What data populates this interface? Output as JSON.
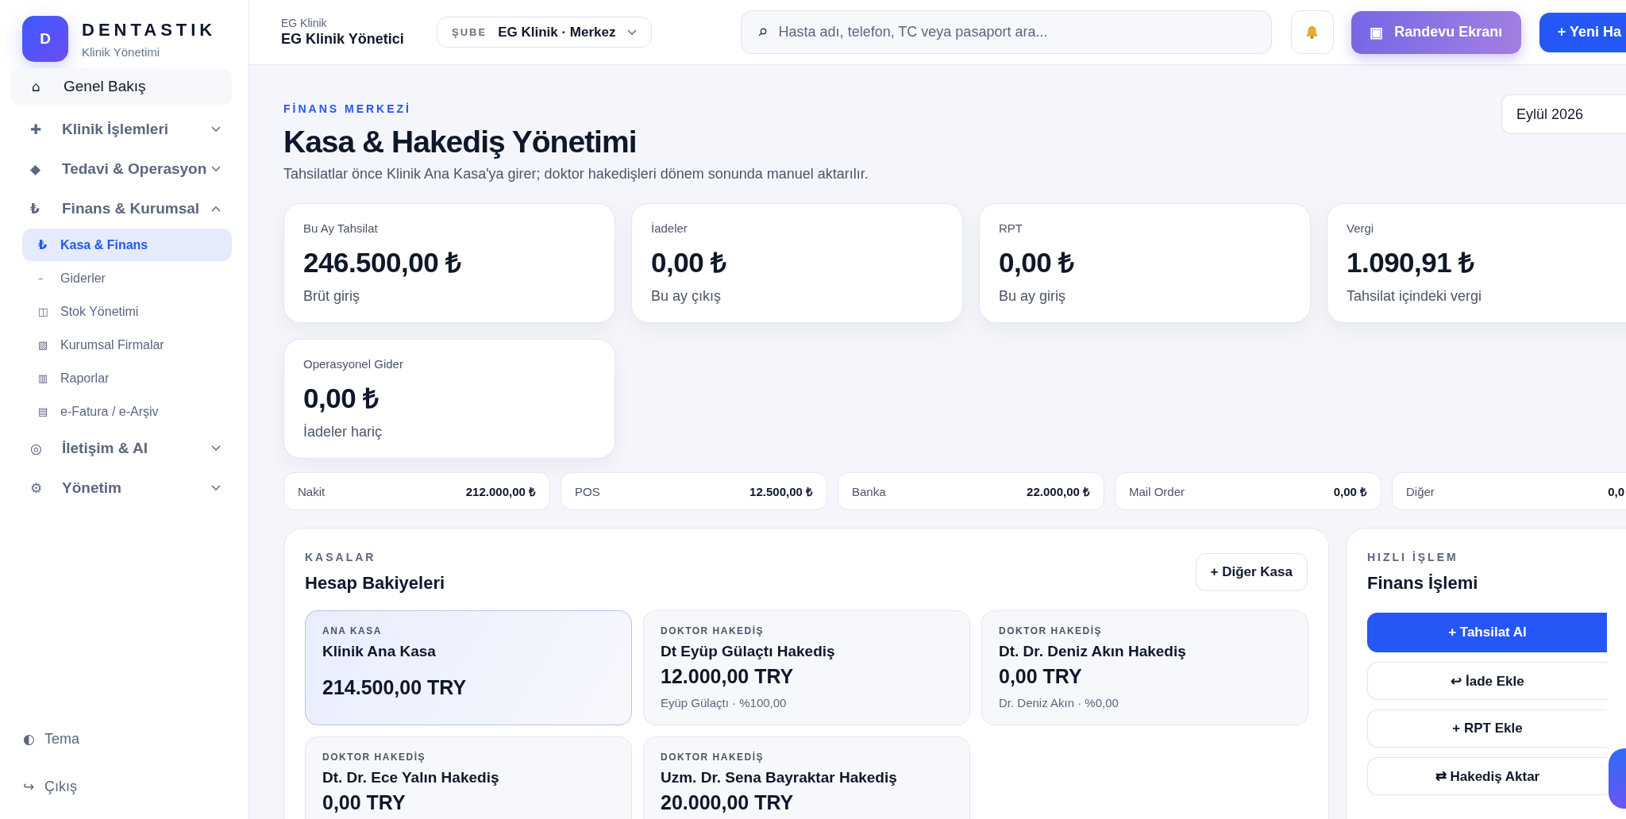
{
  "brand": {
    "logo_letter": "D",
    "name": "DENTASTIK",
    "subtitle": "Klinik Yönetimi"
  },
  "sidebar": {
    "items": [
      {
        "kind": "link",
        "icon": "⌂",
        "label": "Genel Bakış",
        "selected": false
      },
      {
        "kind": "group",
        "icon": "✚",
        "label": "Klinik İşlemleri",
        "expanded": false
      },
      {
        "kind": "group",
        "icon": "◆",
        "label": "Tedavi & Operasyon",
        "expanded": false
      },
      {
        "kind": "group",
        "icon": "₺",
        "label": "Finans & Kurumsal",
        "expanded": true,
        "children": [
          {
            "icon": "₺",
            "label": "Kasa & Finans",
            "selected": true
          },
          {
            "icon": "–",
            "label": "Giderler",
            "selected": false
          },
          {
            "icon": "◫",
            "label": "Stok Yönetimi",
            "selected": false
          },
          {
            "icon": "▧",
            "label": "Kurumsal Firmalar",
            "selected": false
          },
          {
            "icon": "▥",
            "label": "Raporlar",
            "selected": false
          },
          {
            "icon": "▤",
            "label": "e-Fatura / e-Arşiv",
            "selected": false
          }
        ]
      },
      {
        "kind": "group",
        "icon": "◎",
        "label": "İletişim & AI",
        "expanded": false
      },
      {
        "kind": "group",
        "icon": "⚙",
        "label": "Yönetim",
        "expanded": false
      }
    ],
    "footer": [
      {
        "icon": "◐",
        "label": "Tema"
      },
      {
        "icon": "↪",
        "label": "Çıkış"
      }
    ]
  },
  "topbar": {
    "org_caption": "EG Klinik",
    "org_title": "EG Klinik Yönetici",
    "branch": {
      "label": "ŞUBE",
      "value": "EG Klinik · Merkez"
    },
    "search": {
      "placeholder": "Hasta adı, telefon, TC veya pasaport ara..."
    },
    "buttons": [
      {
        "kind": "screen",
        "icon": "▣",
        "label": "Randevu Ekranı"
      },
      {
        "kind": "primary",
        "label": "+ Yeni Ha"
      }
    ]
  },
  "header": {
    "eyebrow": "FİNANS MERKEZİ",
    "title": "Kasa & Hakediş Yönetimi",
    "description": "Tahsilatlar önce Klinik Ana Kasa'ya girer; doktor hakedişleri dönem sonunda manuel aktarılır.",
    "period": "Eylül 2026"
  },
  "stats": [
    {
      "label": "Bu Ay Tahsilat",
      "value": "246.500,00 ₺",
      "note": "Brüt giriş"
    },
    {
      "label": "İadeler",
      "value": "0,00 ₺",
      "note": "Bu ay çıkış"
    },
    {
      "label": "RPT",
      "value": "0,00 ₺",
      "note": "Bu ay giriş"
    },
    {
      "label": "Vergi",
      "value": "1.090,91 ₺",
      "note": "Tahsilat içindeki vergi"
    },
    {
      "label": "Operasyonel Gider",
      "value": "0,00 ₺",
      "note": "İadeler hariç"
    }
  ],
  "payment_methods": [
    {
      "label": "Nakit",
      "amount": "212.000,00 ₺"
    },
    {
      "label": "POS",
      "amount": "12.500,00 ₺"
    },
    {
      "label": "Banka",
      "amount": "22.000,00 ₺"
    },
    {
      "label": "Mail Order",
      "amount": "0,00 ₺"
    },
    {
      "label": "Diğer",
      "amount": "0,0"
    }
  ],
  "accounts_panel": {
    "eyebrow": "KASALAR",
    "title": "Hesap Bakiyeleri",
    "add_button": "+ Diğer Kasa",
    "accounts": [
      {
        "type": "ANA KASA",
        "name": "Klinik Ana Kasa",
        "balance": "214.500,00 TRY",
        "selected": true
      },
      {
        "type": "DOKTOR HAKEDİŞ",
        "name": "Dt Eyüp Gülaçtı Hakediş",
        "balance": "12.000,00 TRY",
        "detail": "Eyüp Gülaçtı · %100,00",
        "selected": false
      },
      {
        "type": "DOKTOR HAKEDİŞ",
        "name": "Dt. Dr. Deniz Akın Hakediş",
        "balance": "0,00 TRY",
        "detail": "Dr. Deniz Akın · %0,00",
        "selected": false
      },
      {
        "type": "DOKTOR HAKEDİŞ",
        "name": "Dt. Dr. Ece Yalın Hakediş",
        "balance": "0,00 TRY",
        "selected": false
      },
      {
        "type": "DOKTOR HAKEDİŞ",
        "name": "Uzm. Dr. Sena Bayraktar Hakediş",
        "balance": "20.000,00 TRY",
        "selected": false
      }
    ]
  },
  "quick_actions": {
    "eyebrow": "HIZLI İŞLEM",
    "title": "Finans İşlemi",
    "actions": [
      {
        "kind": "primary",
        "label": "+ Tahsilat Al"
      },
      {
        "kind": "outline",
        "label": "↩ İade Ekle"
      },
      {
        "kind": "outline",
        "label": "+ RPT Ekle"
      },
      {
        "kind": "outline",
        "label": "⇄ Hakediş Aktar"
      }
    ]
  }
}
